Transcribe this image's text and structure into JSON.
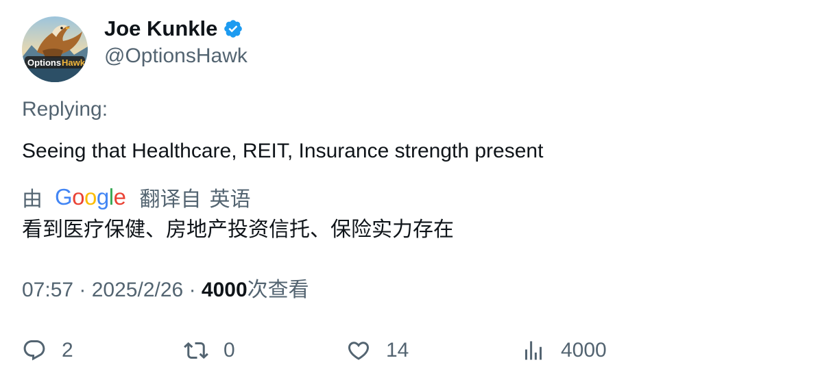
{
  "author": {
    "display_name": "Joe Kunkle",
    "handle": "@OptionsHawk",
    "verified": true,
    "avatar_icon": "options-hawk-logo",
    "avatar_text": "OptionsHawk"
  },
  "reply": {
    "label": "Replying:"
  },
  "tweet": {
    "text": "Seeing that Healthcare, REIT, Insurance strength present"
  },
  "translation": {
    "by_label": "由",
    "provider": "Google",
    "from_label": "翻译自",
    "language": "英语",
    "text": "看到医疗保健、房地产投资信托、保险实力存在"
  },
  "meta": {
    "time": "07:57",
    "separator": "·",
    "date": "2025/2/26",
    "views": "4000",
    "views_label": "次查看"
  },
  "actions": {
    "reply_count": "2",
    "retweet_count": "0",
    "like_count": "14",
    "views_count": "4000"
  },
  "colors": {
    "text_primary": "#0f1419",
    "text_secondary": "#536471",
    "verified_blue": "#1d9bf0"
  }
}
